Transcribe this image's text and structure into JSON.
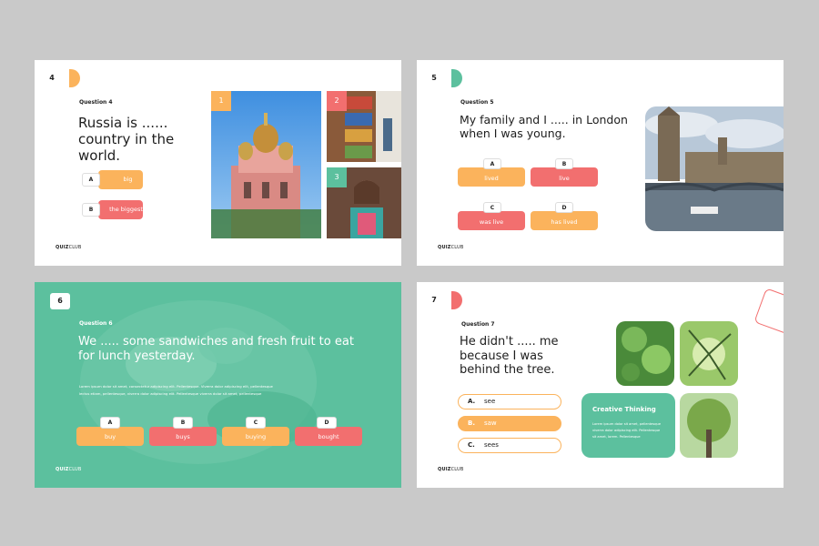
{
  "slides": [
    {
      "number": "4",
      "question_label": "Question 4",
      "question": "Russia is ...... country in the world.",
      "options": [
        {
          "letter": "A",
          "text": "big"
        },
        {
          "letter": "B",
          "text": "the biggest"
        }
      ],
      "photo_badges": [
        "1",
        "2",
        "3"
      ],
      "logo_bold": "QUIZ",
      "logo_light": "CLUB",
      "colors": {
        "tab": "#fbb35c",
        "badge1": "#fbb35c",
        "badge2": "#f26f6f",
        "badge3": "#5cc09e"
      }
    },
    {
      "number": "5",
      "question_label": "Question 5",
      "question": "My family and I ..... in London when I was young.",
      "options": [
        {
          "letter": "A",
          "text": "lived"
        },
        {
          "letter": "B",
          "text": "live"
        },
        {
          "letter": "C",
          "text": "was live"
        },
        {
          "letter": "D",
          "text": "has lived"
        }
      ],
      "logo_bold": "QUIZ",
      "logo_light": "CLUB",
      "colors": {
        "tab": "#5cc09e"
      }
    },
    {
      "number": "6",
      "question_label": "Question 6",
      "question": "We ..... some sandwiches and fresh fruit to eat for lunch yesterday.",
      "body_line1": "Lorem ipsum dolor sit amet, consectetur adipiscing elit. Pellentesque. Viverra dolor adipiscing elit, pellentesque",
      "body_line2": "lectus etiam, pellentesque, viverra dolor adipiscing elit. Pellentesque viverra dolor sit amet, pellentesque",
      "options": [
        {
          "letter": "A",
          "text": "buy"
        },
        {
          "letter": "B",
          "text": "buys"
        },
        {
          "letter": "C",
          "text": "buying"
        },
        {
          "letter": "D",
          "text": "bought"
        }
      ],
      "logo_bold": "QUIZ",
      "logo_light": "CLUB",
      "colors": {
        "background": "#5cc09e"
      }
    },
    {
      "number": "7",
      "question_label": "Question 7",
      "question": "He didn't ..... me because I was behind the tree.",
      "options": [
        {
          "letter": "A.",
          "text": "see"
        },
        {
          "letter": "B.",
          "text": "saw"
        },
        {
          "letter": "C.",
          "text": "sees"
        }
      ],
      "card_title": "Creative Thinking",
      "card_line1": "Lorem ipsum dolor sit amet, pellentesque",
      "card_line2": "viverra dolor adipiscing elit. Pellentesque",
      "card_line3": "sit amet, lorem. Pellentesque",
      "logo_bold": "QUIZ",
      "logo_light": "CLUB",
      "colors": {
        "tab": "#f26f6f"
      }
    }
  ]
}
